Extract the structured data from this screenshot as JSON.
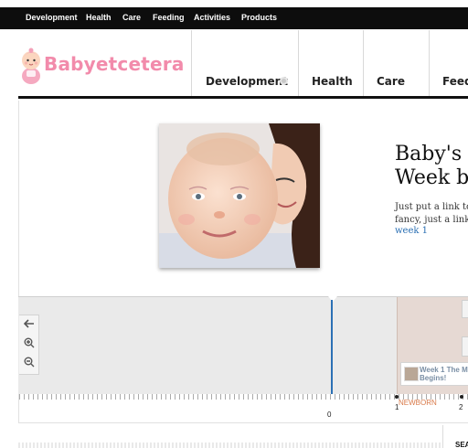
{
  "topnav": {
    "items": [
      "Development",
      "Health",
      "Care",
      "Feeding",
      "Activities",
      "Products"
    ]
  },
  "brand": {
    "name": "Babyetcetera",
    "color": "#f28bab"
  },
  "mainnav": {
    "items": [
      "Development",
      "Health",
      "Care",
      "Feedi"
    ]
  },
  "hero": {
    "title_line1": "Baby's",
    "title_line2": "Week b",
    "desc_line1": "Just put a link to",
    "desc_line2": "fancy, just a link.",
    "link": "week 1"
  },
  "timeline": {
    "zero_label": "0",
    "label_1": "1",
    "label_2": "2",
    "newborn_label": "NEWBORN",
    "event_title_line1": "Week 1 The M",
    "event_title_line2": "Begins!",
    "accent": "#2b70b5"
  },
  "sidebar": {
    "label": "SEA"
  }
}
